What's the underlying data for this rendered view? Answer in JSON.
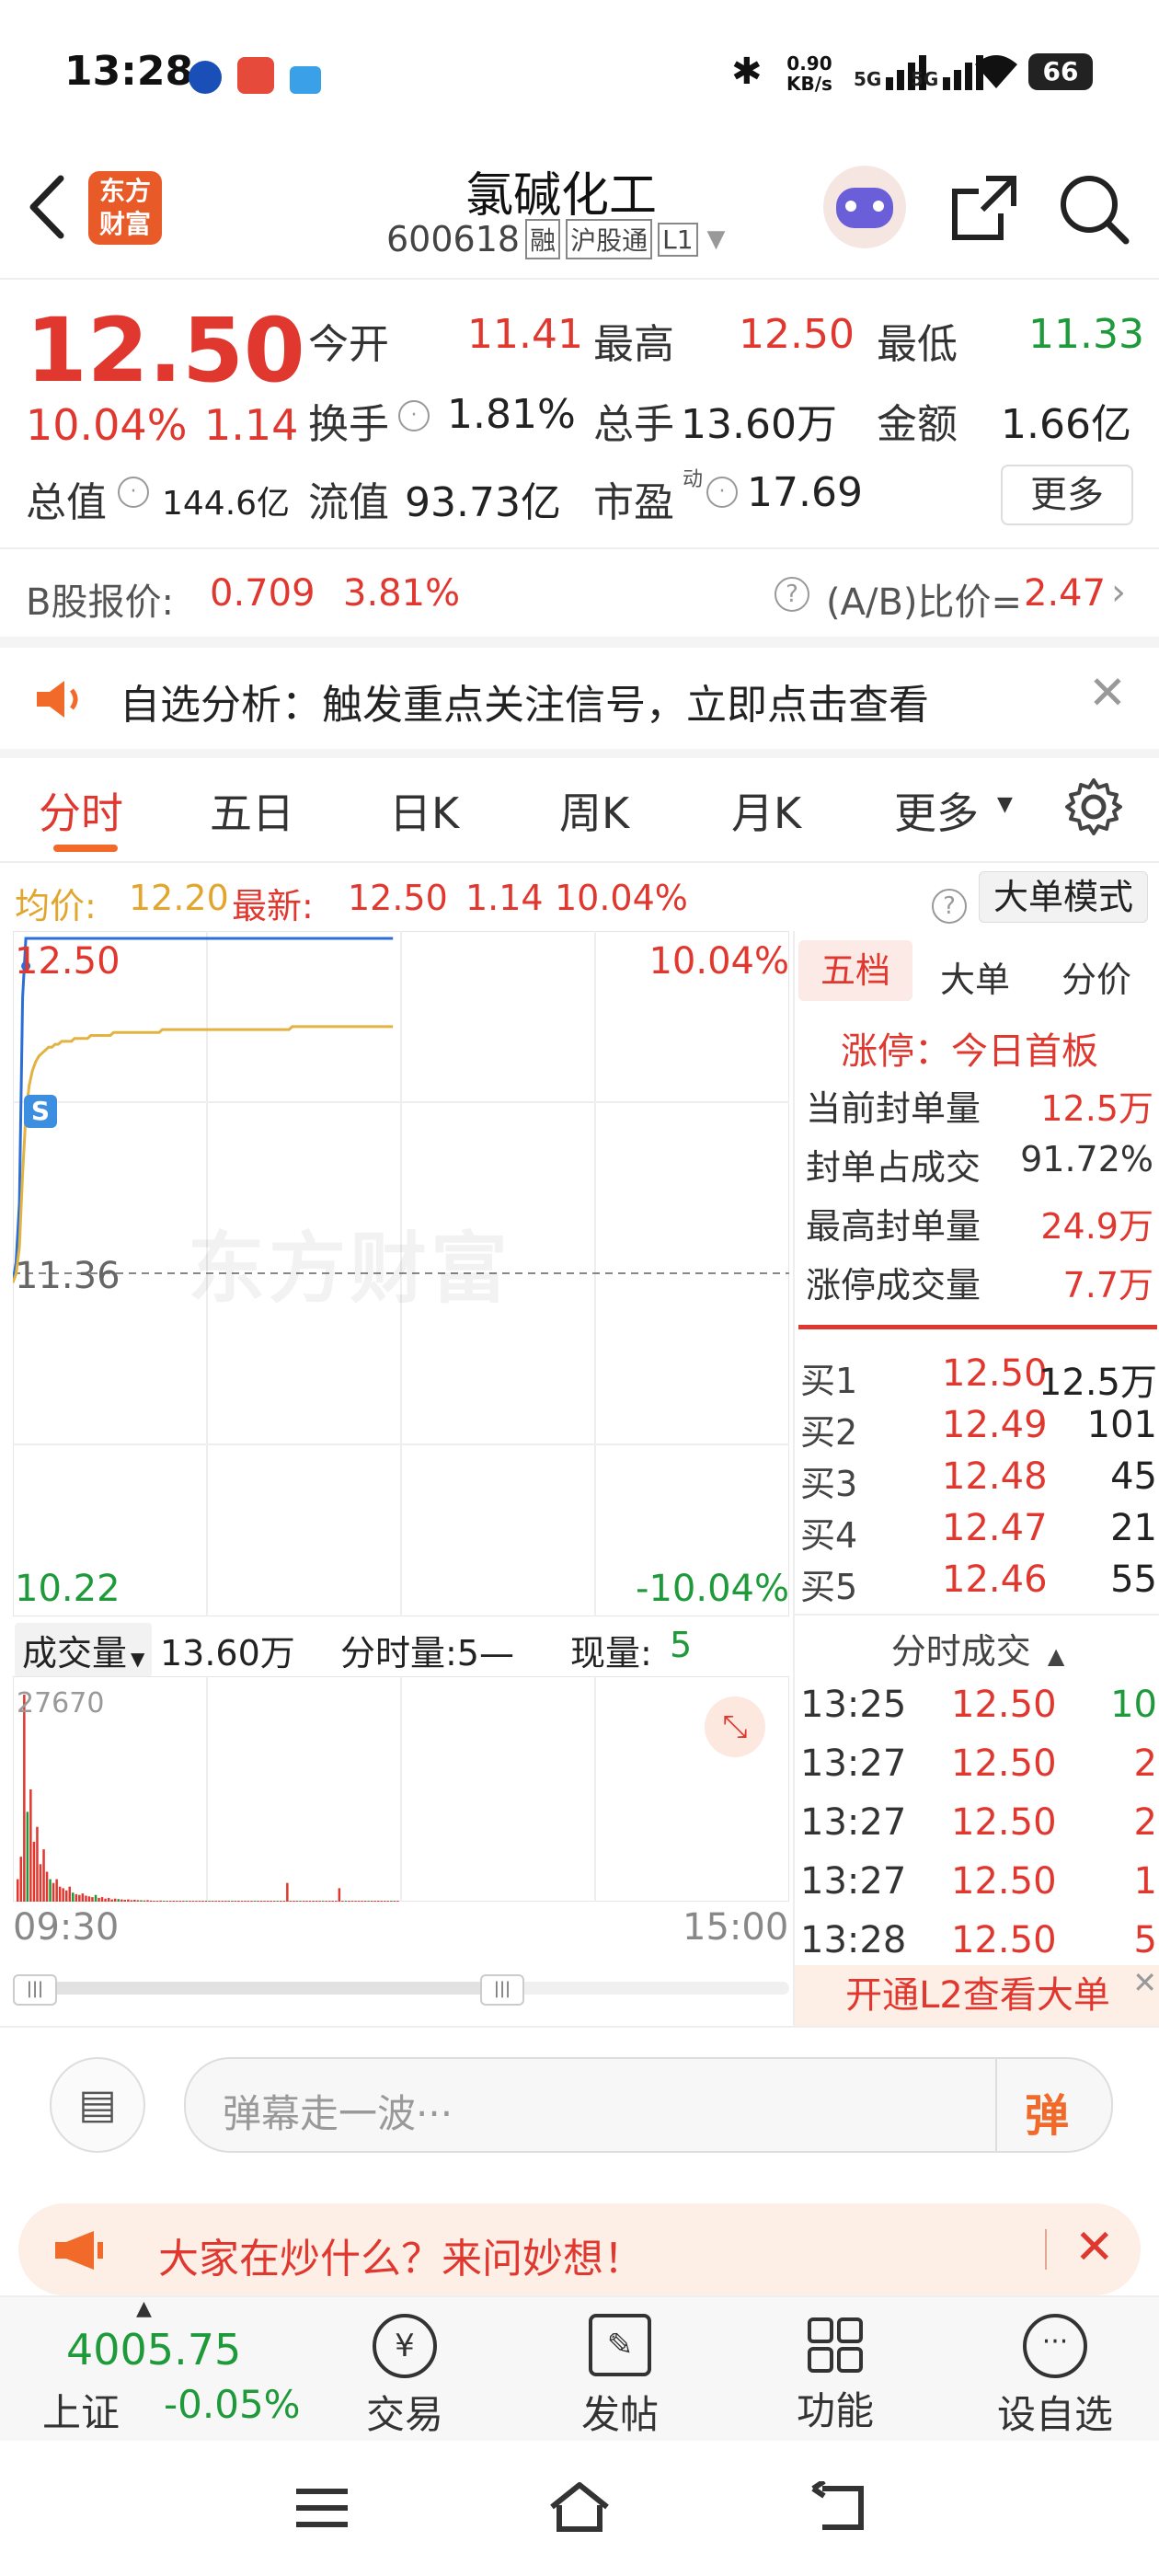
{
  "status_bar": {
    "time": "13:28",
    "net_speed_value": "0.90",
    "net_speed_unit": "KB/s",
    "sig1": "5G",
    "sig2": "5G",
    "battery": "66"
  },
  "header": {
    "title": "氯碱化工",
    "code": "600618",
    "tag1": "融",
    "tag2": "沪股通",
    "tag3": "L1",
    "logo_line1": "东方",
    "logo_line2": "财富"
  },
  "quote": {
    "price": "12.50",
    "change_pct": "10.04%",
    "change": "1.14",
    "open_label": "今开",
    "open": "11.41",
    "high_label": "最高",
    "high": "12.50",
    "low_label": "最低",
    "low": "11.33",
    "turnover_label": "换手",
    "turnover": "1.81%",
    "volume_label": "总手",
    "volume": "13.60万",
    "amount_label": "金额",
    "amount": "1.66亿",
    "mcap_label": "总值",
    "mcap": "144.6亿",
    "float_label": "流值",
    "float_val": "93.73亿",
    "pe_label": "市盈",
    "pe_sup": "动",
    "pe": "17.69",
    "more": "更多"
  },
  "bshare": {
    "label": "B股报价:",
    "price": "0.709",
    "pct": "3.81%",
    "ratio_label": "(A/B)比价=",
    "ratio": "2.47"
  },
  "notice": {
    "text": "自选分析：触发重点关注信号，立即点击查看"
  },
  "tabs": [
    "分时",
    "五日",
    "日K",
    "周K",
    "月K",
    "更多"
  ],
  "info_line": {
    "avg_label": "均价:",
    "avg": "12.20",
    "latest_label": "最新:",
    "latest": "12.50",
    "chg": "1.14",
    "pct": "10.04%",
    "mode": "大单模式"
  },
  "chart_data": {
    "type": "line",
    "title": "",
    "xlabel": "",
    "ylabel": "",
    "x_ticks": [
      "09:30",
      "15:00"
    ],
    "ylim": [
      10.22,
      12.5
    ],
    "y_labels": {
      "top": "12.50",
      "mid": "11.36",
      "bottom": "10.22",
      "top_pct": "10.04%",
      "bottom_pct": "-10.04%"
    },
    "watermark": "东方财富",
    "series": [
      {
        "name": "最新",
        "values": [
          11.33,
          11.4,
          11.6,
          12.3,
          12.5,
          12.5,
          12.5,
          12.5,
          12.5,
          12.5,
          12.5,
          12.5,
          12.5,
          12.5,
          12.5,
          12.5,
          12.5,
          12.5,
          12.5,
          12.5,
          12.5,
          12.5,
          12.5,
          12.5,
          12.5,
          12.5,
          12.5,
          12.5,
          12.5,
          12.5,
          12.5,
          12.5,
          12.5,
          12.5,
          12.5,
          12.5,
          12.5,
          12.5,
          12.5,
          12.5,
          12.5,
          12.5,
          12.5,
          12.5,
          12.5,
          12.5,
          12.5,
          12.5,
          12.5,
          12.5,
          12.5,
          12.5,
          12.5,
          12.5,
          12.5,
          12.5,
          12.5,
          12.5,
          12.5,
          12.5,
          12.5,
          12.5,
          12.5,
          12.5,
          12.5,
          12.5,
          12.5,
          12.5,
          12.5,
          12.5,
          12.5,
          12.5,
          12.5,
          12.5,
          12.5,
          12.5,
          12.5,
          12.5,
          12.5,
          12.5,
          12.5,
          12.5,
          12.5,
          12.5,
          12.5,
          12.5,
          12.5,
          12.5,
          12.5,
          12.5,
          12.5,
          12.5,
          12.5,
          12.5,
          12.5,
          12.5,
          12.5,
          12.5,
          12.5,
          12.5,
          12.5,
          12.5,
          12.5,
          12.5,
          12.5,
          12.5,
          12.5,
          12.5,
          12.5,
          12.5,
          12.5,
          12.5,
          12.5,
          12.5,
          12.5,
          12.5,
          12.5,
          12.5
        ]
      },
      {
        "name": "均价",
        "values": [
          11.33,
          11.36,
          11.45,
          11.7,
          11.9,
          12.0,
          12.05,
          12.08,
          12.1,
          12.11,
          12.12,
          12.13,
          12.13,
          12.14,
          12.14,
          12.15,
          12.15,
          12.15,
          12.15,
          12.16,
          12.16,
          12.16,
          12.16,
          12.16,
          12.17,
          12.17,
          12.17,
          12.17,
          12.17,
          12.17,
          12.17,
          12.18,
          12.18,
          12.18,
          12.18,
          12.18,
          12.18,
          12.18,
          12.18,
          12.18,
          12.18,
          12.18,
          12.18,
          12.18,
          12.18,
          12.18,
          12.19,
          12.19,
          12.19,
          12.19,
          12.19,
          12.19,
          12.19,
          12.19,
          12.19,
          12.19,
          12.19,
          12.19,
          12.19,
          12.19,
          12.19,
          12.19,
          12.19,
          12.19,
          12.19,
          12.19,
          12.19,
          12.19,
          12.19,
          12.19,
          12.19,
          12.19,
          12.19,
          12.19,
          12.19,
          12.19,
          12.19,
          12.19,
          12.19,
          12.19,
          12.19,
          12.19,
          12.19,
          12.19,
          12.19,
          12.19,
          12.2,
          12.2,
          12.2,
          12.2,
          12.2,
          12.2,
          12.2,
          12.2,
          12.2,
          12.2,
          12.2,
          12.2,
          12.2,
          12.2,
          12.2,
          12.2,
          12.2,
          12.2,
          12.2,
          12.2,
          12.2,
          12.2,
          12.2,
          12.2,
          12.2,
          12.2,
          12.2,
          12.2,
          12.2,
          12.2,
          12.2,
          12.2
        ]
      }
    ],
    "volume": {
      "label": "成交量",
      "total": "13.60万",
      "ma_label": "分时量:5—",
      "now_label": "现量:",
      "now": "5",
      "max_label": "27670",
      "max": 27670,
      "values": [
        3000,
        6000,
        27670,
        12000,
        15000,
        8000,
        10000,
        5000,
        7000,
        4000,
        3000,
        2500,
        3000,
        2000,
        1800,
        1500,
        2000,
        1200,
        1000,
        900,
        1100,
        800,
        700,
        600,
        900,
        500,
        600,
        400,
        500,
        300,
        400,
        350,
        300,
        250,
        300,
        200,
        250,
        200,
        180,
        160,
        200,
        150,
        120,
        100,
        150,
        120,
        100,
        90,
        80,
        100,
        80,
        70,
        60,
        80,
        60,
        50,
        60,
        40,
        50,
        40,
        60,
        40,
        30,
        40,
        30,
        50,
        30,
        40,
        30,
        20,
        30,
        40,
        20,
        30,
        20,
        30,
        20,
        40,
        20,
        30,
        20,
        30,
        20,
        2500,
        20,
        30,
        20,
        20,
        30,
        20,
        30,
        20,
        20,
        40,
        30,
        20,
        20,
        30,
        20,
        1800,
        20,
        30,
        20,
        30,
        20,
        20,
        20,
        30,
        20,
        20,
        30,
        20,
        20,
        20,
        20,
        20,
        20,
        10
      ]
    }
  },
  "side_panel": {
    "tabs": [
      "五档",
      "大单",
      "分价"
    ],
    "limit_title": "涨停：今日首板",
    "stats": [
      [
        "当前封单量",
        "12.5万"
      ],
      [
        "封单占成交",
        "91.72%"
      ],
      [
        "最高封单量",
        "24.9万"
      ],
      [
        "涨停成交量",
        "7.7万"
      ]
    ],
    "bids": [
      [
        "买1",
        "12.50",
        "12.5万"
      ],
      [
        "买2",
        "12.49",
        "101"
      ],
      [
        "买3",
        "12.48",
        "45"
      ],
      [
        "买4",
        "12.47",
        "21"
      ],
      [
        "买5",
        "12.46",
        "55"
      ]
    ],
    "ticks_title": "分时成交",
    "ticks": [
      [
        "13:25",
        "12.50",
        "10"
      ],
      [
        "13:27",
        "12.50",
        "2"
      ],
      [
        "13:27",
        "12.50",
        "2"
      ],
      [
        "13:27",
        "12.50",
        "1"
      ],
      [
        "13:28",
        "12.50",
        "5"
      ]
    ],
    "l2_banner": "开通L2查看大单"
  },
  "comment": {
    "placeholder": "弹幕走一波···",
    "send": "弹"
  },
  "promo": {
    "text": "大家在炒什么？来问妙想！"
  },
  "bottom_nav": {
    "index_value": "4005.75",
    "index_name": "上证",
    "index_pct": "-0.05%",
    "items": [
      "交易",
      "发帖",
      "功能",
      "设自选"
    ]
  }
}
